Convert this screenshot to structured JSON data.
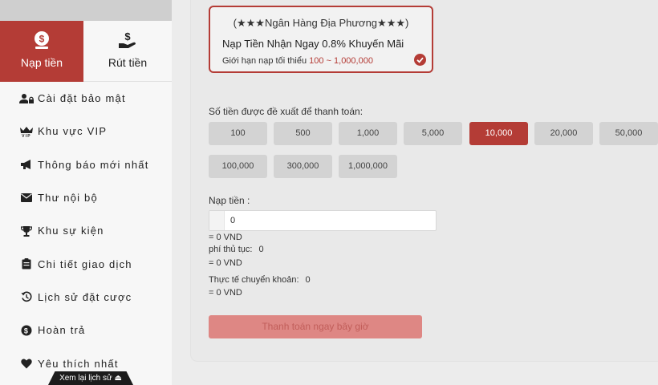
{
  "sidebar": {
    "tabs": [
      {
        "label": "Nạp tiền",
        "icon": "money-bag-icon",
        "active": true
      },
      {
        "label": "Rút tiền",
        "icon": "hand-dollar-icon",
        "active": false
      }
    ],
    "menu": [
      {
        "label": "Cài đặt bảo mật",
        "icon": "user-lock-icon"
      },
      {
        "label": "Khu vực VIP",
        "icon": "vip-crown-icon"
      },
      {
        "label": "Thông báo mới nhất",
        "icon": "megaphone-icon"
      },
      {
        "label": "Thư nội bộ",
        "icon": "envelope-icon"
      },
      {
        "label": "Khu sự kiện",
        "icon": "trophy-icon"
      },
      {
        "label": "Chi tiết giao dịch",
        "icon": "clipboard-icon"
      },
      {
        "label": "Lịch sử đặt cược",
        "icon": "history-icon"
      },
      {
        "label": "Hoàn trả",
        "icon": "dollar-circle-icon"
      },
      {
        "label": "Yêu thích nhất",
        "icon": "heart-icon"
      }
    ],
    "history_tab": "Xem lại lịch sử ⏏"
  },
  "bank": {
    "title": "(★★★Ngân Hàng Địa Phương★★★)",
    "promo": "Nạp Tiền Nhận Ngay 0.8% Khuyến Mãi",
    "limit_label": "Giới hạn nạp tối thiểu",
    "limit_range": "100 ~ 1,000,000",
    "selected": true
  },
  "suggest": {
    "label": "Số tiền được đề xuất để thanh toán:",
    "amounts": [
      "100",
      "500",
      "1,000",
      "5,000",
      "10,000",
      "20,000",
      "50,000",
      "100,000",
      "300,000",
      "1,000,000"
    ],
    "selected": "10,000"
  },
  "deposit": {
    "label": "Nạp tiền :",
    "value": "0",
    "vnd": "= 0 VND"
  },
  "fee": {
    "label": "phí thủ tục:",
    "value": "0",
    "vnd": "= 0 VND"
  },
  "actual": {
    "label": "Thực tế chuyển khoản:",
    "value": "0",
    "vnd": "= 0 VND"
  },
  "pay_button": "Thanh toán ngay bây giờ",
  "colors": {
    "accent": "#b43c36",
    "button_disabled": "#de8784"
  }
}
